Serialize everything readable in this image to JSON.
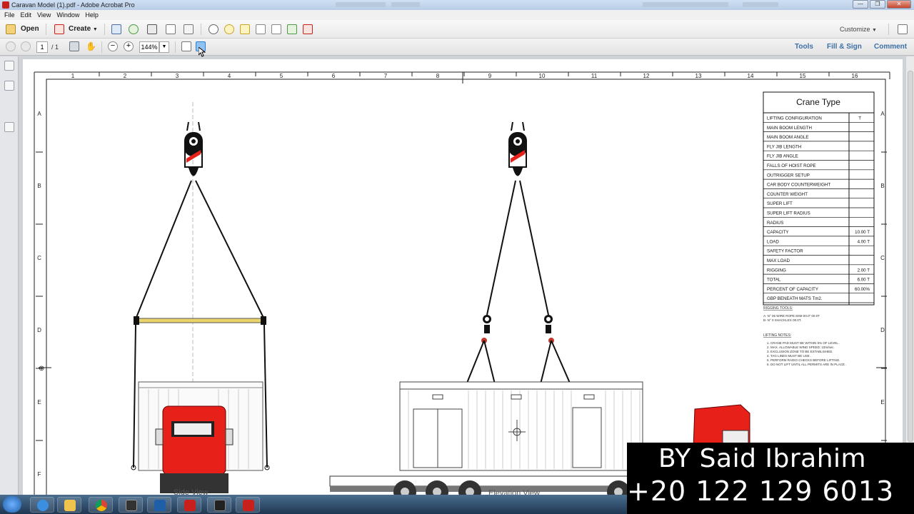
{
  "window": {
    "title": "Caravan Model (1).pdf - Adobe Acrobat Pro",
    "controls": [
      "—",
      "❐",
      "✕"
    ]
  },
  "menu": [
    "File",
    "Edit",
    "View",
    "Window",
    "Help"
  ],
  "toolbar": {
    "open_label": "Open",
    "create_label": "Create",
    "customize_label": "Customize"
  },
  "nav": {
    "page_current": "1",
    "page_total": "/ 1",
    "zoom": "144%",
    "tools_label": "Tools",
    "fill_sign_label": "Fill & Sign",
    "comment_label": "Comment"
  },
  "drawing": {
    "col_numbers": [
      "1",
      "2",
      "3",
      "4",
      "5",
      "6",
      "7",
      "8",
      "9",
      "10",
      "11",
      "12",
      "13",
      "14",
      "15",
      "16"
    ],
    "row_letters": [
      "A",
      "B",
      "C",
      "D",
      "E",
      "F"
    ],
    "side_view_label": "Side View",
    "elevation_view_label": "Elevation View",
    "crane_table": {
      "title": "Crane Type",
      "rows": [
        {
          "label": "LIFTING CONFIGURATION",
          "value": "T"
        },
        {
          "label": "MAIN BOOM LENGTH",
          "value": ""
        },
        {
          "label": "MAIN BOOM ANGLE",
          "value": ""
        },
        {
          "label": "FLY JIB LENGTH",
          "value": ""
        },
        {
          "label": "FLY JIB ANGLE",
          "value": ""
        },
        {
          "label": "FALLS OF HOIST ROPE",
          "value": ""
        },
        {
          "label": "OUTRIGGER SETUP",
          "value": ""
        },
        {
          "label": "CAR BODY COUNTERWEIGHT",
          "value": ""
        },
        {
          "label": "COUNTER WEIGHT",
          "value": ""
        },
        {
          "label": "SUPER LIFT",
          "value": ""
        },
        {
          "label": "SUPER LIFT RADIUS",
          "value": ""
        },
        {
          "label": "RADIUS",
          "value": ""
        },
        {
          "label": "CAPACITY",
          "value": "10.00 T"
        },
        {
          "label": "LOAD",
          "value": "4.00 T"
        },
        {
          "label": "SAFETY FACTOR",
          "value": ""
        },
        {
          "label": "MAX LOAD",
          "value": ""
        },
        {
          "label": "RIGGING",
          "value": "2.00 T"
        },
        {
          "label": "TOTAL",
          "value": "6.00 T"
        },
        {
          "label": "PERCENT OF CAPACITY",
          "value": "60.00%"
        },
        {
          "label": "GBP BENEATH MATS Tm2.",
          "value": ""
        }
      ]
    },
    "rigging_tools": {
      "heading": "RIGGING TOOLS:",
      "items": [
        "A- N° 06 WIRE ROPE 8SM 00.0\" 00.0T",
        "B- N° 0 SHACKLES 00.0T."
      ]
    },
    "lifting_notes": {
      "heading": "LIFTING NOTES:",
      "items": [
        "1.   CRANE PAD MUST BE WITHIN 5% OF LEVEL .",
        "2.   MAX. ALLOWABLE WIND SPEED: 10m/sec.",
        "3.   EXCLUSION ZONE TO BE ESTABLISHED.",
        "4.   TAG LINES MUST BE USE .",
        "5.   PERFORM RADIO CHECKS BEFORE LIFTING.",
        "6.   DO NOT LIFT UNTIL ALL PERMITS ARE IN PLACE ."
      ]
    }
  },
  "banner": {
    "line1": "BY Said Ibrahim",
    "line2": "+20 122 129 6013"
  },
  "colors": {
    "truck_red": "#e8201a",
    "beam_yellow": "#e9d36a",
    "link_blue": "#3d6fa8"
  }
}
